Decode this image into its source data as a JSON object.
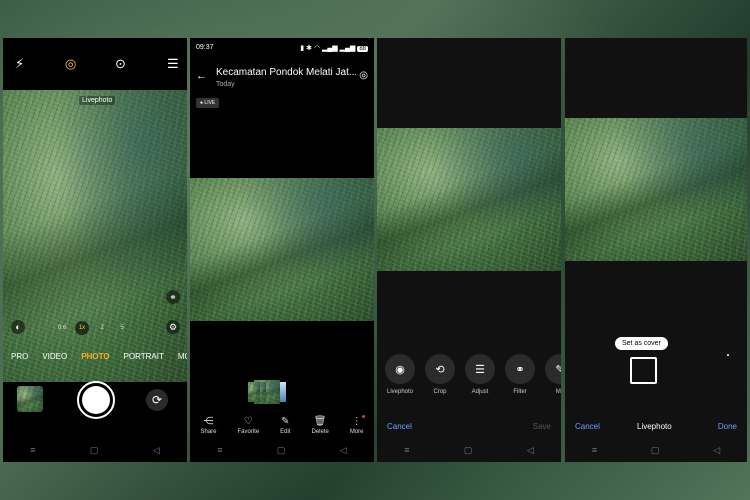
{
  "camera": {
    "livephoto_label": "Livephoto",
    "zoom": [
      "0.6",
      "1x",
      "2",
      "5"
    ],
    "modes": [
      "PRO",
      "VIDEO",
      "PHOTO",
      "PORTRAIT",
      "MO"
    ],
    "active_mode": "PHOTO"
  },
  "gallery": {
    "time": "09:37",
    "battery": "88",
    "title": "Kecamatan Pondok Melati Jat...",
    "subtitle": "Today",
    "live_badge": "LIVE",
    "actions": [
      "Share",
      "Favorite",
      "Edit",
      "Delete",
      "More"
    ]
  },
  "edit": {
    "tools": [
      "Livephoto",
      "Crop",
      "Adjust",
      "Filter",
      "Ma"
    ],
    "cancel": "Cancel",
    "save": "Save"
  },
  "cover": {
    "tip": "Set as cover",
    "cancel": "Cancel",
    "title": "Livephoto",
    "done": "Done"
  },
  "colors": {
    "accent_blue": "#6aa0ff",
    "mode_active": "#ffb020",
    "zoom_active": "#ffcc33"
  }
}
